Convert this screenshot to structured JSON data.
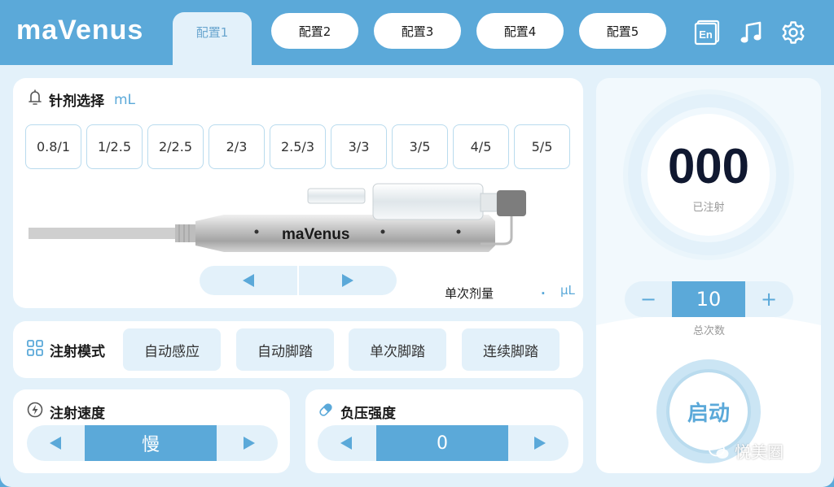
{
  "header": {
    "logo": "maVenus",
    "tabs": [
      {
        "label": "配置1",
        "active": true
      },
      {
        "label": "配置2",
        "active": false
      },
      {
        "label": "配置3",
        "active": false
      },
      {
        "label": "配置4",
        "active": false
      },
      {
        "label": "配置5",
        "active": false
      }
    ],
    "icons": [
      "language-en-icon",
      "music-note-icon",
      "gear-icon"
    ],
    "lang_label": "En"
  },
  "needle": {
    "title": "针剂选择",
    "unit": "mL",
    "options": [
      "0.8/1",
      "1/2.5",
      "2/2.5",
      "2/3",
      "2.5/3",
      "3/3",
      "3/5",
      "4/5",
      "5/5"
    ],
    "device_brand": "maVenus",
    "dose_label": "单次剂量",
    "dose_value": ".",
    "dose_unit": "μL"
  },
  "mode": {
    "title": "注射模式",
    "options": [
      "自动感应",
      "自动脚踏",
      "单次脚踏",
      "连续脚踏"
    ]
  },
  "speed": {
    "title": "注射速度",
    "value": "慢"
  },
  "pressure": {
    "title": "负压强度",
    "value": "0"
  },
  "counter": {
    "value": "000",
    "label": "已注射"
  },
  "total": {
    "value": "10",
    "label": "总次数",
    "minus": "−",
    "plus": "+"
  },
  "start": {
    "label": "启动"
  },
  "watermark": {
    "text": "悦美圈"
  },
  "colors": {
    "accent": "#5ba9d9",
    "background": "#e3f1fa",
    "card": "#ffffff"
  }
}
